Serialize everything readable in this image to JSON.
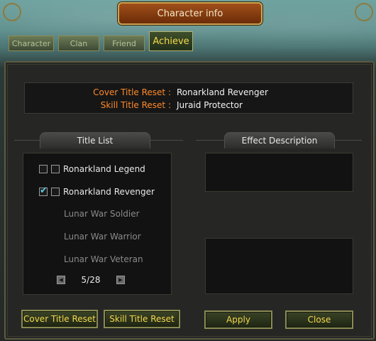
{
  "window": {
    "title": "Character info"
  },
  "tabs": [
    {
      "label": "Character"
    },
    {
      "label": "Clan"
    },
    {
      "label": "Friend"
    },
    {
      "label": "Achieve",
      "active": true
    }
  ],
  "resets": {
    "cover": {
      "label": "Cover Title Reset :",
      "value": "Ronarkland Revenger"
    },
    "skill": {
      "label": "Skill Title Reset :",
      "value": "Juraid Protector"
    }
  },
  "title_list": {
    "header": "Title List",
    "items": [
      {
        "label": "Ronarkland Legend",
        "checked": false,
        "has_checkboxes": true
      },
      {
        "label": "Ronarkland Revenger",
        "checked": true,
        "has_checkboxes": true
      },
      {
        "label": "Lunar War Soldier",
        "checked": false,
        "has_checkboxes": false
      },
      {
        "label": "Lunar War Warrior",
        "checked": false,
        "has_checkboxes": false
      },
      {
        "label": "Lunar War Veteran",
        "checked": false,
        "has_checkboxes": false
      }
    ],
    "page": "5/28"
  },
  "effect": {
    "header": "Effect Description"
  },
  "buttons": {
    "cover_reset": "Cover Title Reset",
    "skill_reset": "Skill Title Reset",
    "apply": "Apply",
    "close": "Close"
  },
  "colors": {
    "accent": "#f4d84c",
    "reset_label": "#ff8a2a",
    "check": "#5fc8e8"
  }
}
